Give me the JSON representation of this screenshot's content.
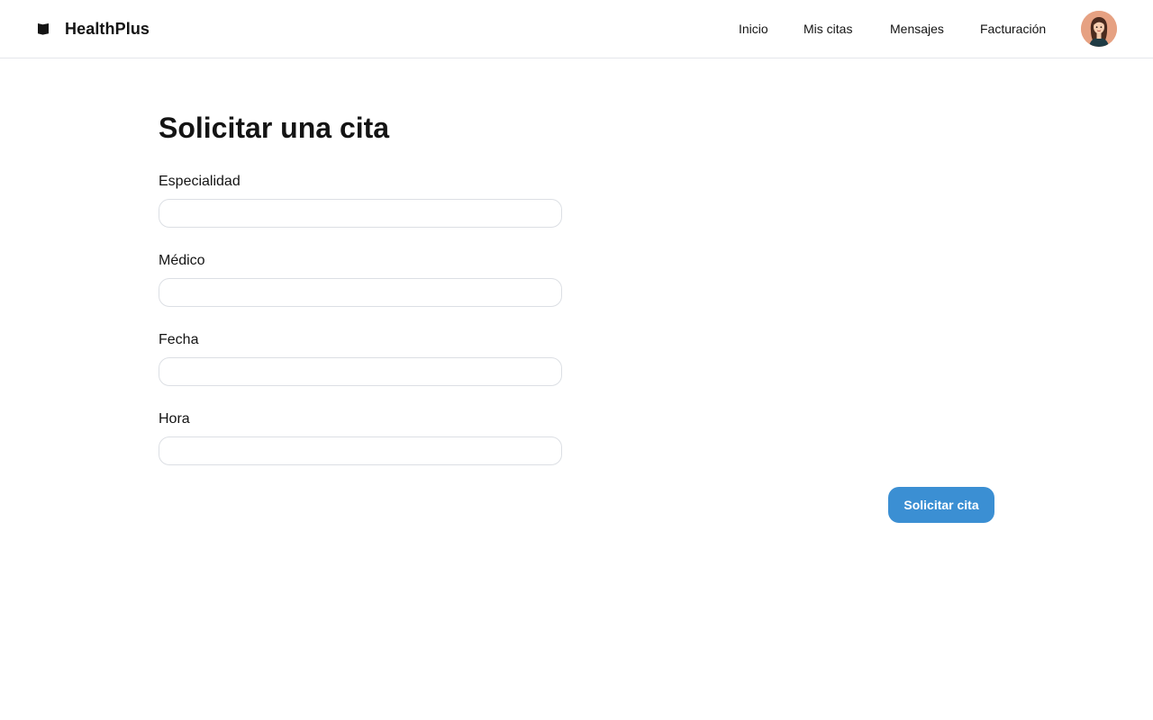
{
  "header": {
    "brand_name": "HealthPlus",
    "brand_icon": "flag-icon",
    "nav": [
      {
        "label": "Inicio"
      },
      {
        "label": "Mis citas"
      },
      {
        "label": "Mensajes"
      },
      {
        "label": "Facturación"
      }
    ],
    "avatar_icon": "user-avatar"
  },
  "main": {
    "title": "Solicitar una cita",
    "fields": [
      {
        "label": "Especialidad",
        "value": "",
        "placeholder": ""
      },
      {
        "label": "Médico",
        "value": "",
        "placeholder": ""
      },
      {
        "label": "Fecha",
        "value": "",
        "placeholder": ""
      },
      {
        "label": "Hora",
        "value": "",
        "placeholder": ""
      }
    ],
    "submit_label": "Solicitar cita"
  },
  "colors": {
    "accent": "#3b8fd3",
    "text": "#141414",
    "border": "#dcdfe4",
    "avatar_bg": "#e6a182"
  }
}
